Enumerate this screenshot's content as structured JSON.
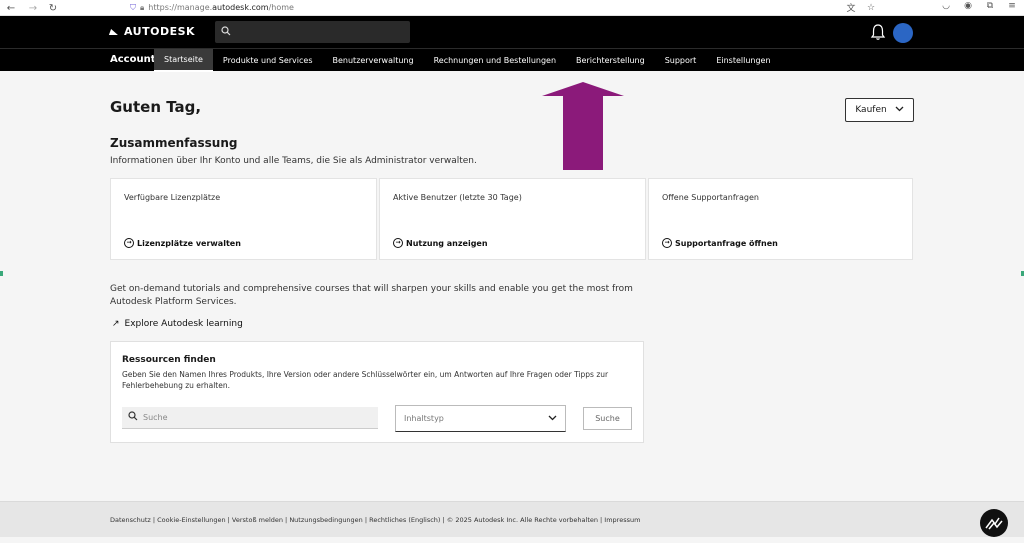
{
  "browser": {
    "url_prefix": "https://manage.",
    "url_host": "autodesk.com",
    "url_path": "/home"
  },
  "header": {
    "logo_text": "AUTODESK",
    "search_placeholder": ""
  },
  "account_nav": {
    "label": "Account",
    "tabs": [
      {
        "label": "Startseite",
        "active": true
      },
      {
        "label": "Produkte und Services",
        "active": false
      },
      {
        "label": "Benutzerverwaltung",
        "active": false
      },
      {
        "label": "Rechnungen und Bestellungen",
        "active": false
      },
      {
        "label": "Berichterstellung",
        "active": false
      },
      {
        "label": "Support",
        "active": false
      },
      {
        "label": "Einstellungen",
        "active": false
      }
    ]
  },
  "main": {
    "greeting": "Guten Tag,",
    "buy_button": "Kaufen",
    "summary_title": "Zusammenfassung",
    "summary_desc": "Informationen über Ihr Konto und alle Teams, die Sie als Administrator verwalten.",
    "cards": [
      {
        "title": "Verfügbare Lizenzplätze",
        "link": "Lizenzplätze verwalten"
      },
      {
        "title": "Aktive Benutzer (letzte 30 Tage)",
        "link": "Nutzung anzeigen"
      },
      {
        "title": "Offene Supportanfragen",
        "link": "Supportanfrage öffnen"
      }
    ],
    "learn_text": "Get on-demand tutorials and comprehensive courses that will sharpen your skills and enable you get the most from Autodesk Platform Services.",
    "learn_link": "Explore Autodesk learning"
  },
  "resources": {
    "title": "Ressourcen finden",
    "desc": "Geben Sie den Namen Ihres Produkts, Ihre Version oder andere Schlüsselwörter ein, um Antworten auf Ihre Fragen oder Tipps zur Fehlerbehebung zu erhalten.",
    "search_placeholder": "Suche",
    "content_type_placeholder": "Inhaltstyp",
    "search_button": "Suche"
  },
  "footer": {
    "text": "Datenschutz | Cookie-Einstellungen | Verstoß melden | Nutzungsbedingungen | Rechtliches (Englisch) | © 2025 Autodesk Inc. Alle Rechte vorbehalten | Impressum"
  },
  "colors": {
    "header_bg": "#000000",
    "avatar": "#2b66c4",
    "annotation_arrow": "#8b1a7a"
  }
}
